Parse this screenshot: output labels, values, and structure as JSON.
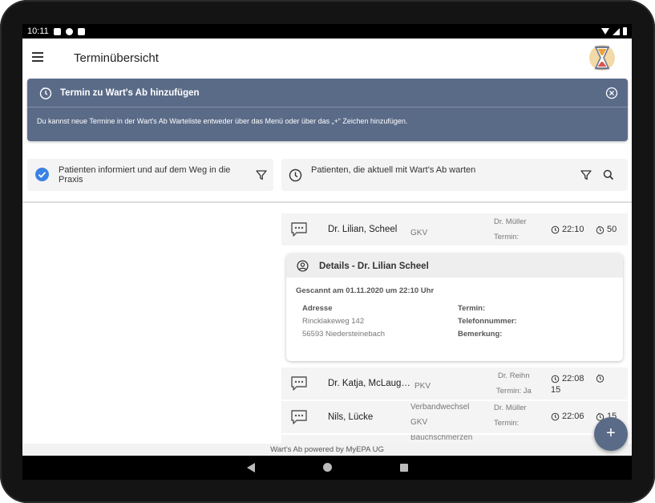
{
  "status_bar": {
    "time": "10:11"
  },
  "app_bar": {
    "title": "Terminübersicht"
  },
  "banner": {
    "title": "Termin zu Wart's Ab hinzufügen",
    "text": "Du kannst neue Termine in der Wart's Ab Warteliste entweder über das Menü oder über das „+“ Zeichen hinzufügen."
  },
  "filters": {
    "left": "Patienten informiert und auf dem Weg in die Praxis",
    "right": "Patienten, die aktuell mit Wart's Ab warten"
  },
  "rows": [
    {
      "name": "Dr. Lilian, Scheel",
      "insurance": "GKV",
      "doctor": "Dr. Müller",
      "sub": "Termin:",
      "time": "22:10",
      "wait": "50"
    },
    {
      "name": "Dr. Katja, McLaughlin",
      "insurance": "PKV",
      "doctor": "Dr. Reihn",
      "sub": "Termin: Ja",
      "time": "22:08",
      "wait": "15"
    },
    {
      "name": "Nils, Lücke",
      "insurance_line1": "Verbandwechsel",
      "insurance": "GKV",
      "doctor": "Dr. Müller",
      "sub": "Termin:",
      "time": "22:06",
      "wait": "15"
    },
    {
      "name": "",
      "insurance_line1": "Bauchschmerzen"
    }
  ],
  "details": {
    "title": "Details - Dr. Lilian Scheel",
    "scanned": "Gescannt am 01.11.2020 um 22:10 Uhr",
    "address_label": "Adresse",
    "street": "Rincklakeweg 142",
    "city": "56593 Niedersteinebach",
    "termin_label": "Termin:",
    "phone_label": "Telefonnummer:",
    "remark_label": "Bemerkung:"
  },
  "footer": {
    "text": "Wart's Ab powered by MyEPA UG"
  },
  "fab": {
    "label": "+"
  },
  "colors": {
    "primary": "#5a6b88",
    "accent_check": "#3b82e4"
  }
}
